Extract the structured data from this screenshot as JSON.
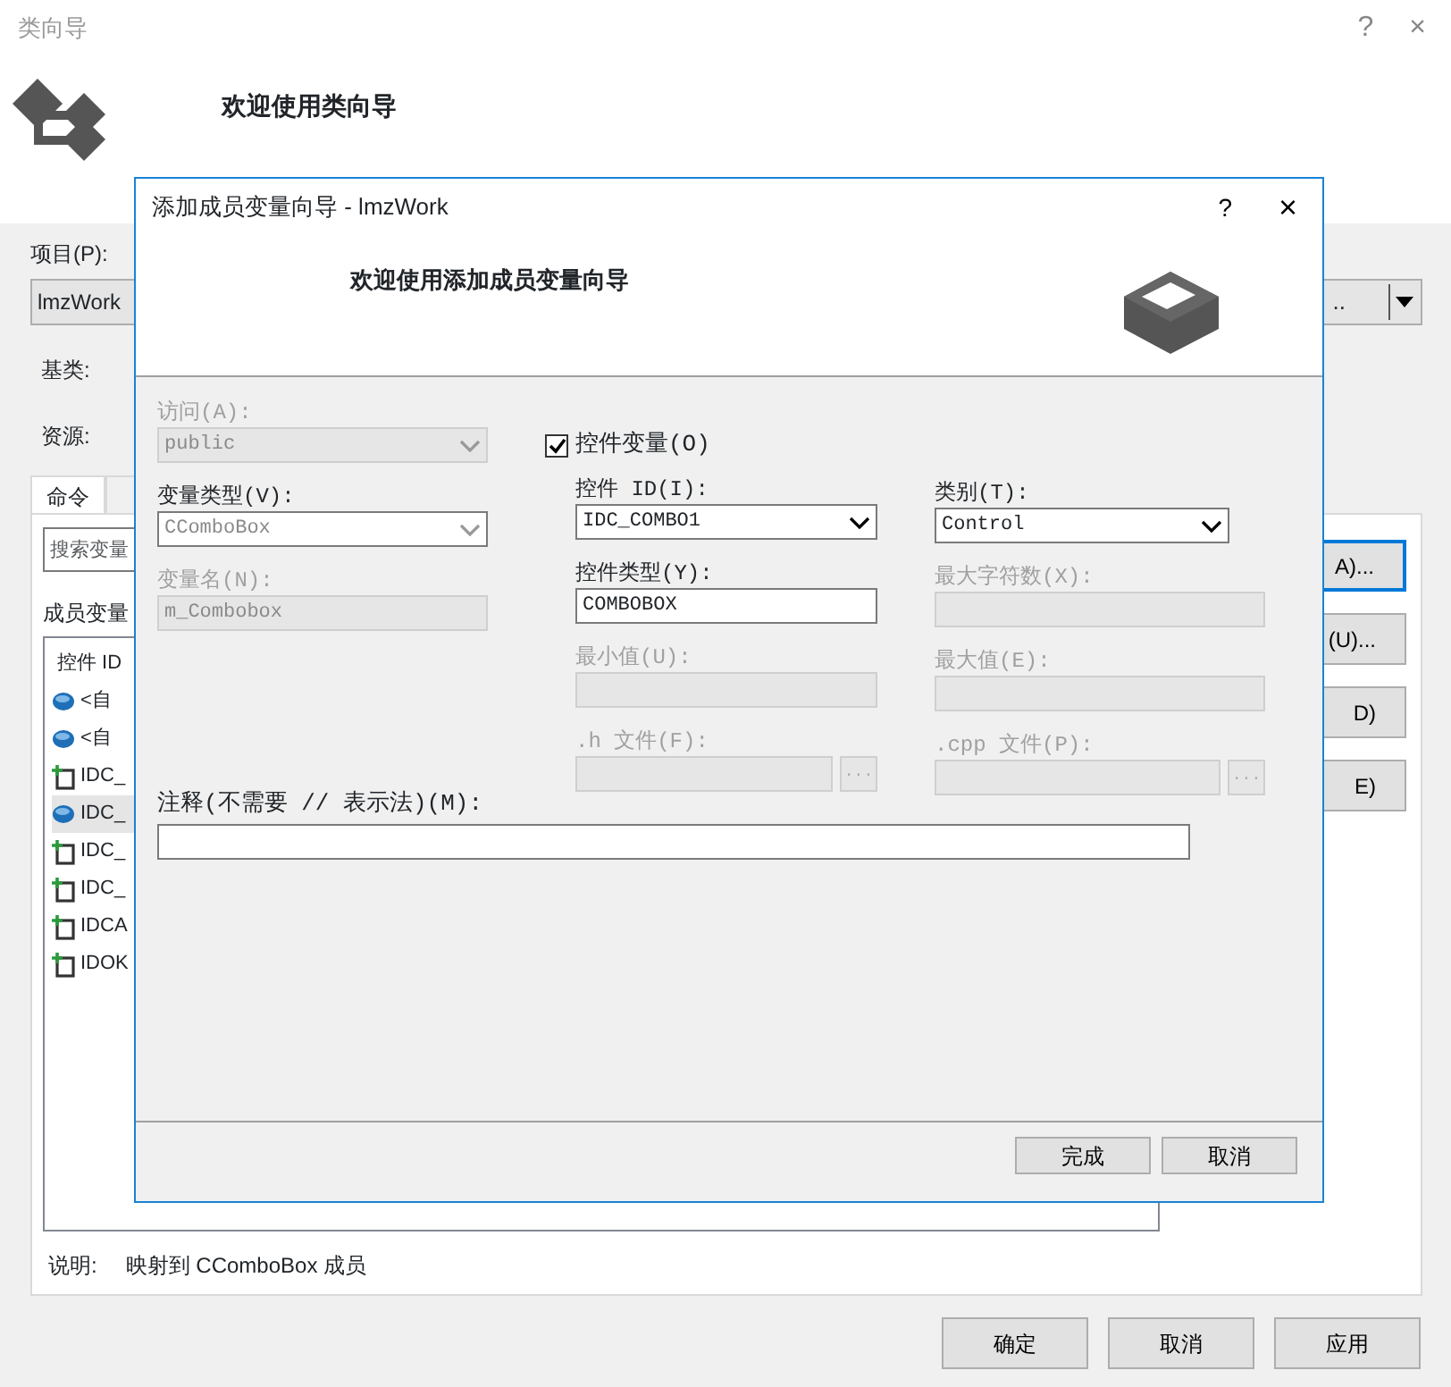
{
  "window": {
    "title": "类向导",
    "help": "?",
    "close": "×"
  },
  "header": {
    "heading": "欢迎使用类向导"
  },
  "project": {
    "label": "项目(P):",
    "value": "lmzWork"
  },
  "class_combo": {
    "value": ".."
  },
  "base_class": {
    "label": "基类:"
  },
  "resource": {
    "label": "资源:"
  },
  "tabs": [
    {
      "label": "命令",
      "selected": true
    },
    {
      "selected": false
    }
  ],
  "search": {
    "placeholder": "搜索变量"
  },
  "members_label": "成员变量",
  "member_list": {
    "column_1": "控件 ID",
    "rows": [
      {
        "kind": "member",
        "text": "<自",
        "selected": false
      },
      {
        "kind": "member",
        "text": "<自",
        "selected": false
      },
      {
        "kind": "control",
        "text": "IDC_",
        "selected": false
      },
      {
        "kind": "member",
        "text": "IDC_",
        "selected": true
      },
      {
        "kind": "control",
        "text": "IDC_",
        "selected": false
      },
      {
        "kind": "control",
        "text": "IDC_",
        "selected": false
      },
      {
        "kind": "control",
        "text": "IDCA",
        "selected": false
      },
      {
        "kind": "control",
        "text": "IDOK",
        "selected": false
      }
    ]
  },
  "side_buttons": [
    {
      "label": "A)...",
      "default": true
    },
    {
      "label": "(U)...",
      "default": false
    },
    {
      "label": "D)",
      "default": false
    },
    {
      "label": "E)",
      "default": false
    }
  ],
  "description": {
    "label": "说明:",
    "text": "映射到 CComboBox 成员"
  },
  "buttons": [
    "确定",
    "取消",
    "应用"
  ],
  "dialog": {
    "title": "添加成员变量向导 - lmzWork",
    "help": "?",
    "close": "×",
    "heading": "欢迎使用添加成员变量向导",
    "columns": [
      {
        "fields": [
          {
            "kind": "combo",
            "label": "访问(A):",
            "value": "public",
            "disabled": true,
            "muted": true
          },
          {
            "kind": "combo",
            "label": "变量类型(V):",
            "value": "CComboBox",
            "disabled": false,
            "muted": true
          },
          {
            "kind": "input",
            "label": "变量名(N):",
            "value": "m_Combobox",
            "disabled": true,
            "muted": true
          }
        ]
      },
      {
        "fields": [
          {
            "kind": "checkbox",
            "label": "控件变量(O)",
            "checked": true
          },
          {
            "kind": "combo",
            "label": "控件 ID(I):",
            "value": "IDC_COMBO1",
            "disabled": false,
            "muted": false
          },
          {
            "kind": "input",
            "label": "控件类型(Y):",
            "value": "COMBOBOX",
            "disabled": false,
            "muted": false
          },
          {
            "kind": "input",
            "label": "最小值(U):",
            "disabled": true,
            "muted": true
          },
          {
            "kind": "file",
            "label": ".h 文件(F):",
            "browse": "...",
            "disabled": true,
            "muted": true
          }
        ]
      },
      {
        "fields": [
          {
            "kind": "combo",
            "label": "类别(T):",
            "value": "Control",
            "disabled": false,
            "muted": false
          },
          {
            "kind": "input",
            "label": "最大字符数(X):",
            "disabled": true,
            "muted": true
          },
          {
            "kind": "input",
            "label": "最大值(E):",
            "disabled": true,
            "muted": true
          },
          {
            "kind": "file",
            "label": ".cpp 文件(P):",
            "browse": "...",
            "disabled": true,
            "muted": true
          }
        ]
      }
    ],
    "comment": {
      "label": "注释(不需要 // 表示法)(M):",
      "disabled": false
    },
    "buttons": [
      "完成",
      "取消"
    ]
  }
}
